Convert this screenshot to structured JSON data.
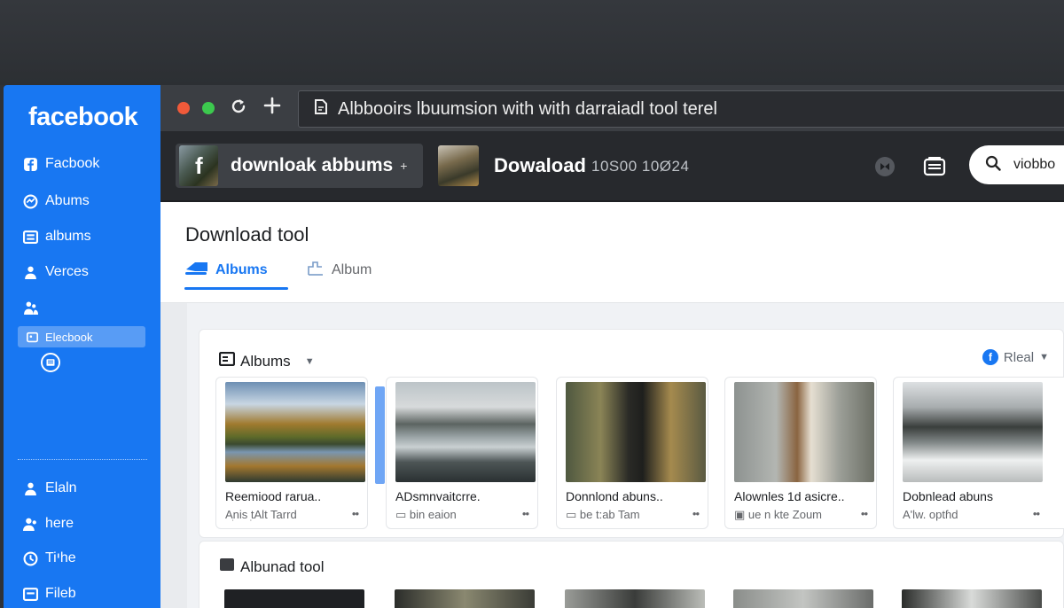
{
  "sidebar": {
    "logo": "facebook",
    "items": [
      {
        "label": "Facbook"
      },
      {
        "label": "Abums"
      },
      {
        "label": "albums"
      },
      {
        "label": "Verces"
      },
      {
        "label": ""
      }
    ],
    "active_label": "Elecbook",
    "bottom_items": [
      {
        "label": "Elaln"
      },
      {
        "label": "here"
      },
      {
        "label": "Tiיhe"
      },
      {
        "label": "Fileb"
      }
    ]
  },
  "browser": {
    "url": "Albbooirs lbuumsion with with darraiadl tool terel"
  },
  "header": {
    "tab_label": "downloak  abbums",
    "title": "Dowaload",
    "meta": "10S00  10Ø24",
    "search_value": "viobbo"
  },
  "main": {
    "page_title": "Download tool",
    "tabs": [
      {
        "label": "Albums",
        "active": true
      },
      {
        "label": "Album",
        "active": false
      }
    ],
    "section": {
      "title": "Albums",
      "filter_label": "Rleal"
    },
    "cards": [
      {
        "title": "Reemiood rarua..",
        "subtitle": "Aׅnis  ׅtAlt Tarrd",
        "more": "••"
      },
      {
        "title": "ADsmnvaitcrre.",
        "subtitle": "bin eaion",
        "more": "••"
      },
      {
        "title": "Donnlond abuns..",
        "subtitle": "be t:ab Tam",
        "more": "••"
      },
      {
        "title": "Alownles 1d asicre..",
        "subtitle": "ue  n kte Zoum",
        "more": "••"
      },
      {
        "title": "Dobnlead abuns",
        "subtitle": "A'lw. optɦd",
        "more": "••"
      }
    ],
    "section2": {
      "title": "Albunad  tool"
    }
  },
  "colors": {
    "brand": "#1877f2",
    "chrome": "#3b3e43",
    "header": "#27292d"
  }
}
